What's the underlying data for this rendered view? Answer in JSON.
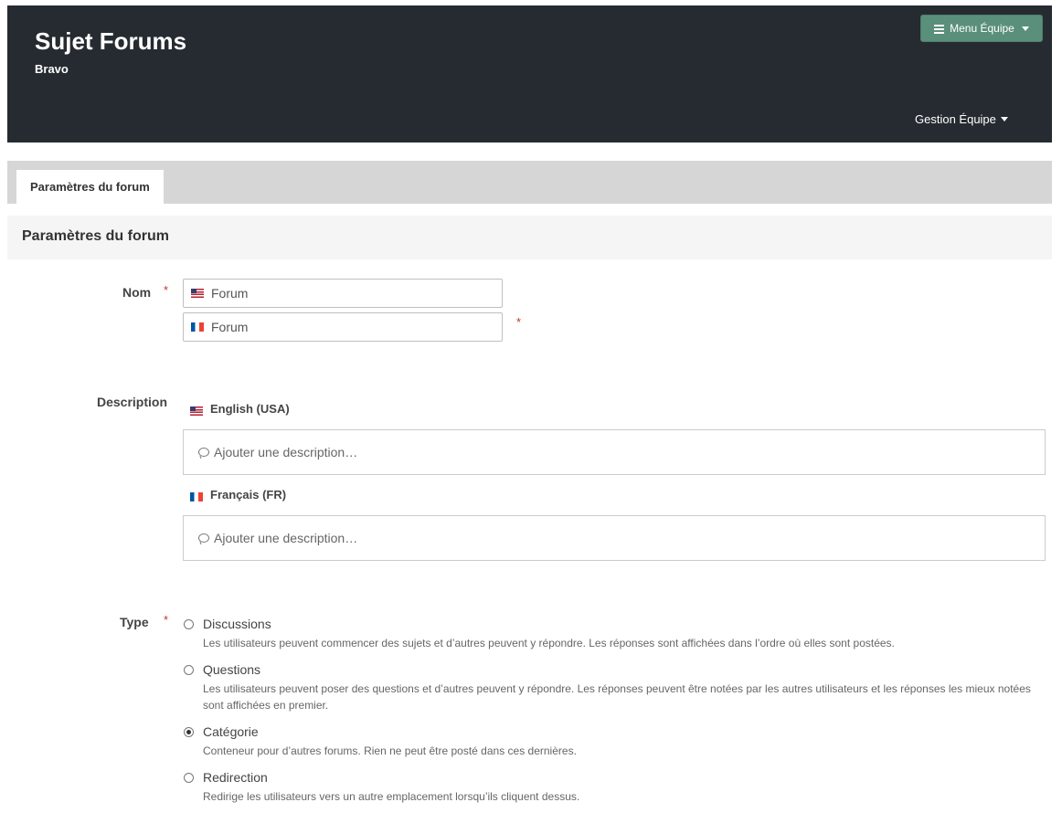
{
  "header": {
    "title": "Sujet Forums",
    "subtitle": "Bravo",
    "menu_button": "Menu Équipe",
    "team_management": "Gestion Équipe"
  },
  "tabs": [
    {
      "label": "Paramètres du forum",
      "active": true
    }
  ],
  "section": {
    "title": "Paramètres du forum"
  },
  "form": {
    "name": {
      "label": "Nom",
      "required_mark": "*",
      "inputs": [
        {
          "lang": "en-US",
          "flag": "us-flag-icon",
          "value": "Forum"
        },
        {
          "lang": "fr-FR",
          "flag": "fr-flag-icon",
          "value": "Forum"
        }
      ]
    },
    "description": {
      "label": "Description",
      "languages": [
        {
          "name": "English (USA)",
          "flag": "us-flag-icon",
          "placeholder": "Ajouter une description…"
        },
        {
          "name": "Français (FR)",
          "flag": "fr-flag-icon",
          "placeholder": "Ajouter une description…"
        }
      ]
    },
    "type": {
      "label": "Type",
      "required_mark": "*",
      "selected": "Catégorie",
      "options": [
        {
          "label": "Discussions",
          "description": "Les utilisateurs peuvent commencer des sujets et d’autres peuvent y répondre. Les réponses sont affichées dans l’ordre où elles sont postées.",
          "checked": false
        },
        {
          "label": "Questions",
          "description": "Les utilisateurs peuvent poser des questions et d’autres peuvent y répondre. Les réponses peuvent être notées par les autres utilisateurs et les réponses les mieux notées sont affichées en premier.",
          "checked": false
        },
        {
          "label": "Catégorie",
          "description": "Conteneur pour d’autres forums. Rien ne peut être posté dans ces dernières.",
          "checked": true
        },
        {
          "label": "Redirection",
          "description": "Redirige les utilisateurs vers un autre emplacement lorsqu’ils cliquent dessus.",
          "checked": false
        }
      ]
    }
  },
  "colors": {
    "header_bg": "#262b31",
    "menu_button_bg": "#5a8f7b",
    "required": "#c0392b",
    "tabbar_bg": "#d6d6d6"
  }
}
